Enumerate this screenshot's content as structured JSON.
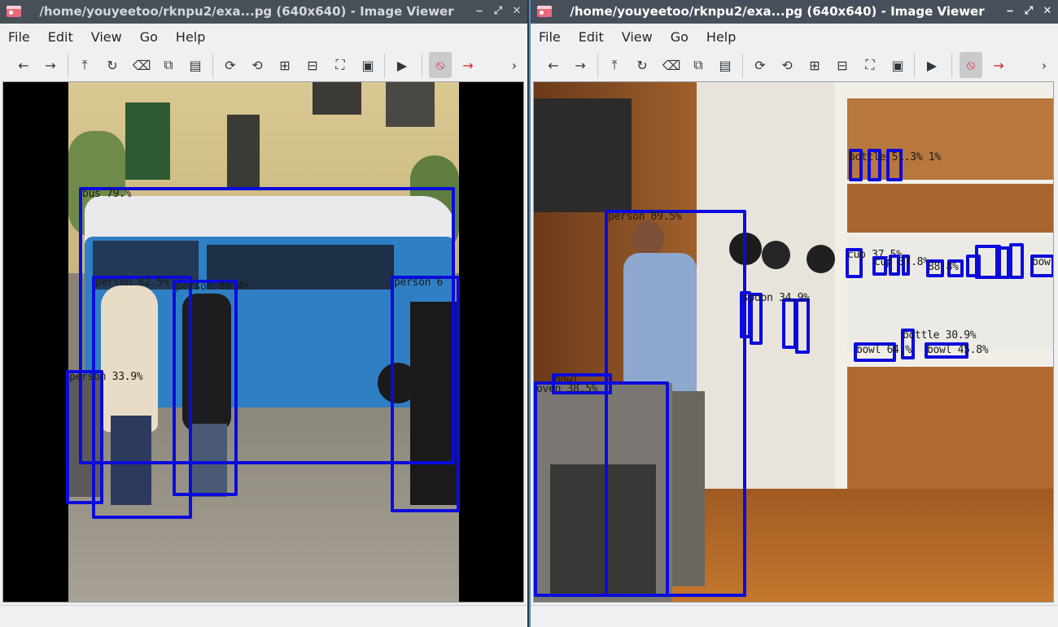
{
  "windows": [
    {
      "title": "/home/youyeetoo/rknpu2/exa...pg (640x640) - Image Viewer",
      "menus": [
        "File",
        "Edit",
        "View",
        "Go",
        "Help"
      ],
      "detections": [
        {
          "label": "bus 79.%"
        },
        {
          "label": "person 82.5%"
        },
        {
          "label": "person 88.4%"
        },
        {
          "label": "person 6"
        },
        {
          "label": "person 33.9%"
        }
      ]
    },
    {
      "title": "/home/youyeetoo/rknpu2/exa...pg (640x640) - Image Viewer",
      "menus": [
        "File",
        "Edit",
        "View",
        "Go",
        "Help"
      ],
      "detections": [
        {
          "label": "person 89.5%"
        },
        {
          "label": "bottle 51.3% 1%"
        },
        {
          "label": "cup 37.5%"
        },
        {
          "label": "cup 37.8%"
        },
        {
          "label": "88.8%"
        },
        {
          "label": "bow"
        },
        {
          "label": "spoon 34.9%"
        },
        {
          "label": "bottle 30.9%"
        },
        {
          "label": "bowl 64.%"
        },
        {
          "label": "bowl 45.8%"
        },
        {
          "label": "bowl"
        },
        {
          "label": "oven 38.5%"
        }
      ]
    }
  ],
  "toolbar_icons": [
    "back-icon",
    "forward-icon",
    "upload-icon",
    "reload-icon",
    "delete-icon",
    "copy-icon",
    "paste-icon",
    "rotate-right-icon",
    "rotate-left-icon",
    "zoom-in-icon",
    "zoom-out-icon",
    "fit-icon",
    "original-size-icon",
    "slideshow-icon",
    "stop-icon",
    "next-arrow-icon",
    "more-icon"
  ],
  "colors": {
    "detection_box": "#0b0bdc",
    "titlebar": "#475057",
    "active_border": "#3d8ee0",
    "stop": "#e0202a"
  }
}
